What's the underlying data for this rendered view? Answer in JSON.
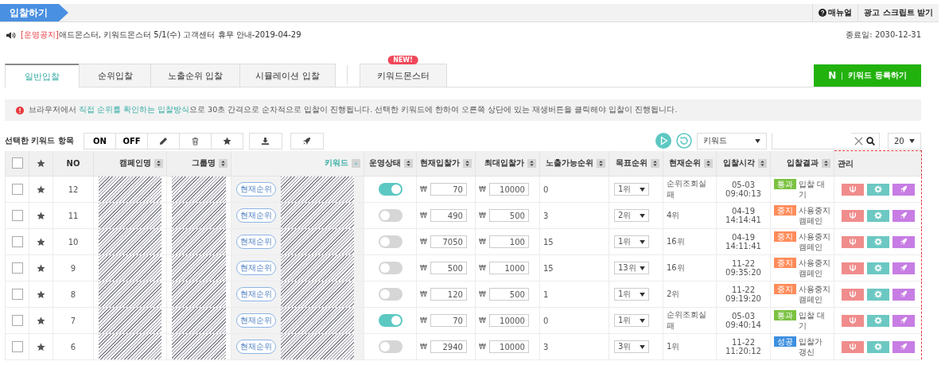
{
  "header": {
    "title": "입찰하기",
    "links": [
      {
        "kind": "help",
        "label": "매뉴얼"
      },
      {
        "kind": "plain",
        "label": "광고 스크립트 받기"
      }
    ]
  },
  "notice": {
    "tag": "[운영공지]",
    "text": "애드몬스터, 키워드몬스터 5/1(수) 고객센터 휴무 안내-2019-04-29"
  },
  "end_date": "종료일: 2030-12-31",
  "tabs": [
    {
      "label": "일반입찰",
      "selected": true
    },
    {
      "label": "순위입찰",
      "selected": false
    },
    {
      "label": "노출순위 입찰",
      "selected": false
    },
    {
      "label": "시뮬레이션 입찰",
      "selected": false
    },
    {
      "label": "키워드몬스터",
      "selected": false,
      "badge": "NEW!"
    }
  ],
  "register_button": {
    "logo": "N",
    "label": "키워드 등록하기"
  },
  "info": [
    {
      "text": "브라우저에서 ",
      "highlight": false
    },
    {
      "text": "직접 순위를 확인하는 입찰방식",
      "highlight": true
    },
    {
      "text": "으로 30초 간격으로 순차적으로 입찰이 진행됩니다. 선택한 키워드에 한하여 오른쪽 상단에 있는 재생버튼을 클릭해야 입찰이 진행됩니다.",
      "highlight": false
    }
  ],
  "toolbar": {
    "label": "선택한 키워드 항목",
    "buttons": [
      {
        "kind": "text",
        "label": "ON"
      },
      {
        "kind": "text",
        "label": "OFF"
      },
      {
        "kind": "pencil"
      },
      {
        "kind": "trash"
      },
      {
        "kind": "star"
      },
      {
        "kind": "download"
      },
      {
        "kind": "rocket"
      }
    ],
    "filter": "키워드",
    "page_size": "20"
  },
  "table": {
    "select_all_checked": false,
    "columns": [
      {
        "sortable": false,
        "sorted": false
      },
      {
        "sortable": false,
        "sorted": false
      },
      {
        "label": "NO",
        "sortable": false,
        "sorted": false
      },
      {
        "label": "캠페인명",
        "sortable": true,
        "sorted": false
      },
      {
        "label": "그룹명",
        "sortable": true,
        "sorted": false
      },
      {
        "label": "키워드",
        "sortable": true,
        "sorted": true
      },
      {
        "label": "운영상태",
        "sortable": true,
        "sorted": false
      },
      {
        "label": "현재입찰가",
        "sortable": true,
        "sorted": false
      },
      {
        "label": "최대입찰가",
        "sortable": true,
        "sorted": false
      },
      {
        "label": "노출가능순위",
        "sortable": true,
        "sorted": false
      },
      {
        "label": "목표순위",
        "sortable": true,
        "sorted": false
      },
      {
        "label": "현재순위",
        "sortable": true,
        "sorted": false
      },
      {
        "label": "입찰시각",
        "sortable": true,
        "sorted": false
      },
      {
        "label": "입찰결과",
        "sortable": true,
        "sorted": false
      },
      {
        "label": "관리",
        "sortable": false,
        "sorted": false
      }
    ],
    "rows": [
      {
        "checked": false,
        "no": "12",
        "rank_badge": "현재순위",
        "on": true,
        "currency": "₩",
        "current_bid": "70",
        "max_bid": "10000",
        "exposable": "0",
        "target": "1위",
        "current_rank": "순위조회실패",
        "date": "05-03",
        "time": "09:40:13",
        "status": "통과",
        "color": "#7cc242",
        "result": "입찰 대기"
      },
      {
        "checked": false,
        "no": "11",
        "rank_badge": "현재순위",
        "on": false,
        "currency": "₩",
        "current_bid": "490",
        "max_bid": "500",
        "exposable": "3",
        "target": "2위",
        "current_rank": "4위",
        "date": "04-19",
        "time": "14:14:41",
        "status": "중지",
        "color": "#ff8c5a",
        "result": "사용중지 캠페인"
      },
      {
        "checked": false,
        "no": "10",
        "rank_badge": "현재순위",
        "on": false,
        "currency": "₩",
        "current_bid": "7050",
        "max_bid": "100",
        "exposable": "15",
        "target": "1위",
        "current_rank": "16위",
        "date": "04-19",
        "time": "14:11:41",
        "status": "중지",
        "color": "#ff8c5a",
        "result": "사용중지 캠페인"
      },
      {
        "checked": false,
        "no": "9",
        "rank_badge": "현재순위",
        "on": false,
        "currency": "₩",
        "current_bid": "500",
        "max_bid": "1000",
        "exposable": "15",
        "target": "13위",
        "current_rank": "16위",
        "date": "11-22",
        "time": "09:35:20",
        "status": "중지",
        "color": "#ff8c5a",
        "result": "사용중지 캠페인"
      },
      {
        "checked": false,
        "no": "8",
        "rank_badge": "현재순위",
        "on": false,
        "currency": "₩",
        "current_bid": "120",
        "max_bid": "500",
        "exposable": "1",
        "target": "1위",
        "current_rank": "2위",
        "date": "11-22",
        "time": "09:19:20",
        "status": "중지",
        "color": "#ff8c5a",
        "result": "사용중지 캠페인"
      },
      {
        "checked": false,
        "no": "7",
        "rank_badge": "현재순위",
        "on": true,
        "currency": "₩",
        "current_bid": "70",
        "max_bid": "10000",
        "exposable": "0",
        "target": "1위",
        "current_rank": "순위조회실패",
        "date": "05-03",
        "time": "09:40:14",
        "status": "통과",
        "color": "#7cc242",
        "result": "입찰 대기"
      },
      {
        "checked": false,
        "no": "6",
        "rank_badge": "현재순위",
        "on": false,
        "currency": "₩",
        "current_bid": "2940",
        "max_bid": "10000",
        "exposable": "3",
        "target": "3위",
        "current_rank": "1위",
        "date": "11-22",
        "time": "11:20:12",
        "status": "성공",
        "color": "#3d8fe0",
        "result": "입찰가 갱신"
      }
    ]
  }
}
